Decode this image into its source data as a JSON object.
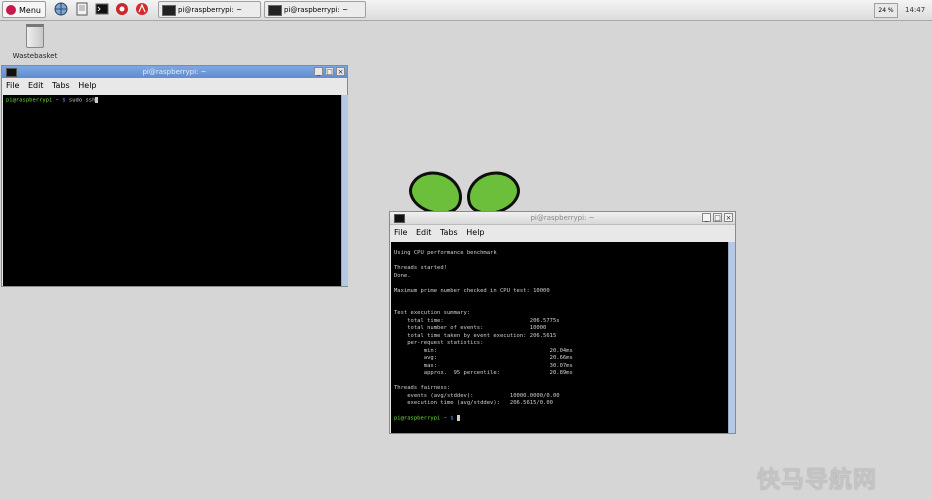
{
  "panel": {
    "menu_label": "Menu",
    "taskbar": [
      {
        "label": "pi@raspberrypi: ~"
      },
      {
        "label": "pi@raspberrypi: ~"
      }
    ],
    "tray_label": "24 %",
    "clock": "14:47"
  },
  "desktop": {
    "wastebasket_label": "Wastebasket"
  },
  "window1": {
    "title": "pi@raspberrypi: ~",
    "menu": [
      "File",
      "Edit",
      "Tabs",
      "Help"
    ],
    "prompt_user": "pi@raspberrypi",
    "prompt_path": " ~ $",
    "command": " sudo ssh"
  },
  "window2": {
    "title": "pi@raspberrypi: ~",
    "menu": [
      "File",
      "Edit",
      "Tabs",
      "Help"
    ],
    "output": [
      "Using CPU performance benchmark",
      "",
      "Threads started!",
      "Done.",
      "",
      "Maximum prime number checked in CPU test: 10000",
      "",
      "",
      "Test execution summary:",
      "    total time:                          206.5775s",
      "    total number of events:              10000",
      "    total time taken by event execution: 206.5615",
      "    per-request statistics:",
      "         min:                                  20.04ms",
      "         avg:                                  20.66ms",
      "         max:                                  30.07ms",
      "         approx.  95 percentile:               20.89ms",
      "",
      "Threads fairness:",
      "    events (avg/stddev):           10000.0000/0.00",
      "    execution time (avg/stddev):   206.5615/0.00",
      ""
    ],
    "prompt_user": "pi@raspberrypi",
    "prompt_path": " ~ $"
  },
  "watermark": "快马导航网",
  "colors": {
    "titlebar_active": "#6b97d9",
    "terminal_bg": "#000000",
    "prompt_user": "#6fe03a",
    "prompt_path": "#5a86ff",
    "leaf_green": "#6cbf3a"
  }
}
